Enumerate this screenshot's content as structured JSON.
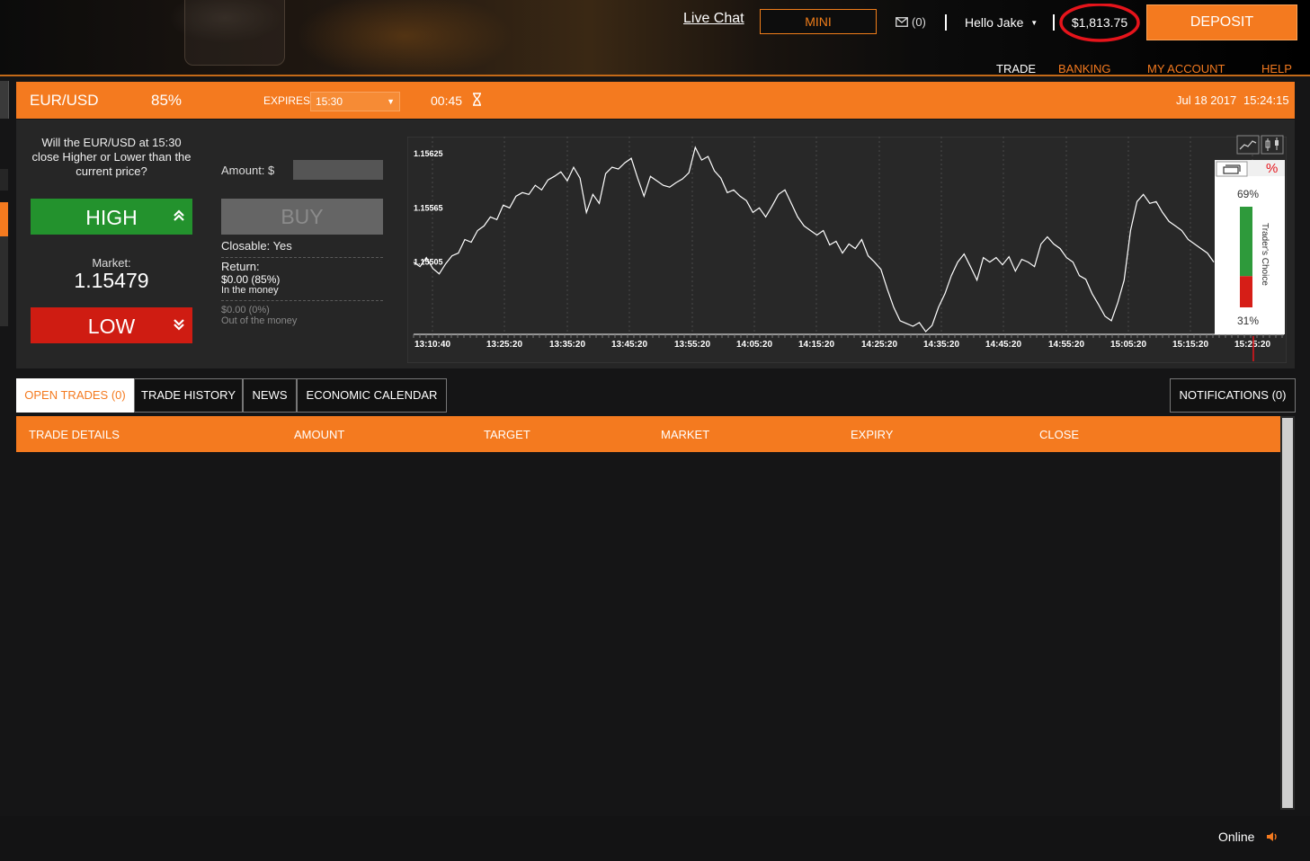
{
  "header": {
    "live_chat": "Live Chat",
    "mini": "MINI",
    "messages_count": "(0)",
    "greeting": "Hello Jake",
    "balance": "$1,813.75",
    "deposit": "DEPOSIT",
    "nav": [
      "TRADE",
      "BANKING",
      "MY ACCOUNT",
      "HELP"
    ],
    "nav_active": "TRADE"
  },
  "trade_bar": {
    "asset": "EUR/USD",
    "payout": "85%",
    "expires_label": "EXPIRES:",
    "expires_value": "15:30",
    "countdown": "00:45",
    "date": "Jul 18 2017",
    "time": "15:24:15"
  },
  "trade_panel": {
    "question": "Will the EUR/USD at 15:30 close Higher or Lower than the current price?",
    "high": "HIGH",
    "low": "LOW",
    "market_label": "Market:",
    "market_value": "1.15479",
    "amount_label": "Amount: $",
    "amount_value": "",
    "buy": "BUY",
    "closable": "Closable: Yes",
    "return_label": "Return:",
    "return_in": "$0.00 (85%)",
    "return_in_note": "In the money",
    "return_out": "$0.00 (0%)",
    "return_out_note": "Out of the money"
  },
  "chart_data": {
    "type": "line",
    "x_ticks": [
      "13:10:40",
      "13:25:20",
      "13:35:20",
      "13:45:20",
      "13:55:20",
      "14:05:20",
      "14:15:20",
      "14:25:20",
      "14:35:20",
      "14:45:20",
      "14:55:20",
      "15:05:20",
      "15:15:20",
      "15:25:20"
    ],
    "y_ticks": [
      "1.15625",
      "1.15565",
      "1.15505"
    ],
    "y_tick_values": [
      1.15625,
      1.15565,
      1.15505
    ],
    "series": [
      {
        "values": [
          1.15505,
          1.155,
          1.1551,
          1.15498,
          1.15492,
          1.15503,
          1.15512,
          1.15515,
          1.1553,
          1.15527,
          1.1554,
          1.15545,
          1.15555,
          1.15552,
          1.15568,
          1.15565,
          1.15578,
          1.15582,
          1.1558,
          1.1559,
          1.15585,
          1.15596,
          1.156,
          1.15605,
          1.15595,
          1.1561,
          1.15598,
          1.1556,
          1.1558,
          1.1557,
          1.15603,
          1.1561,
          1.15608,
          1.15615,
          1.1562,
          1.15598,
          1.15578,
          1.156,
          1.15595,
          1.1559,
          1.15588,
          1.15593,
          1.15597,
          1.15604,
          1.15632,
          1.15618,
          1.15622,
          1.15606,
          1.15598,
          1.15582,
          1.15585,
          1.15578,
          1.15573,
          1.1556,
          1.15565,
          1.15555,
          1.15567,
          1.1558,
          1.15585,
          1.1557,
          1.15555,
          1.15545,
          1.1554,
          1.15535,
          1.1554,
          1.15524,
          1.15528,
          1.15515,
          1.15525,
          1.1552,
          1.1553,
          1.15512,
          1.15505,
          1.15497,
          1.15475,
          1.15455,
          1.1544,
          1.15437,
          1.15434,
          1.15438,
          1.15428,
          1.15435,
          1.15455,
          1.1547,
          1.1549,
          1.15505,
          1.15514,
          1.155,
          1.15485,
          1.1551,
          1.15505,
          1.1551,
          1.15502,
          1.15511,
          1.15495,
          1.15508,
          1.15505,
          1.155,
          1.15525,
          1.15533,
          1.15525,
          1.1552,
          1.1551,
          1.15505,
          1.1549,
          1.15486,
          1.1547,
          1.15458,
          1.15445,
          1.1544,
          1.1546,
          1.15485,
          1.1554,
          1.15572,
          1.1558,
          1.1557,
          1.15572,
          1.1556,
          1.1555,
          1.15545,
          1.1554,
          1.1553,
          1.15525,
          1.1552,
          1.15515,
          1.15505
        ]
      }
    ],
    "ylim": [
      1.15425,
      1.1564
    ],
    "traders_choice": {
      "label": "Trader's Choice",
      "high_pct": 69,
      "low_pct": 31,
      "high_text": "69%",
      "low_text": "31%"
    }
  },
  "tabs": {
    "open_trades": "OPEN TRADES (0)",
    "trade_history": "TRADE HISTORY",
    "news": "NEWS",
    "economic_calendar": "ECONOMIC CALENDAR",
    "notifications": "NOTIFICATIONS (0)"
  },
  "table": {
    "columns": [
      "TRADE DETAILS",
      "AMOUNT",
      "TARGET",
      "MARKET",
      "EXPIRY",
      "CLOSE"
    ]
  },
  "footer": {
    "status": "Online"
  },
  "colors": {
    "accent": "#f47a1f",
    "high": "#23922d",
    "low": "#cf1c12",
    "annotation": "#e5141b"
  }
}
